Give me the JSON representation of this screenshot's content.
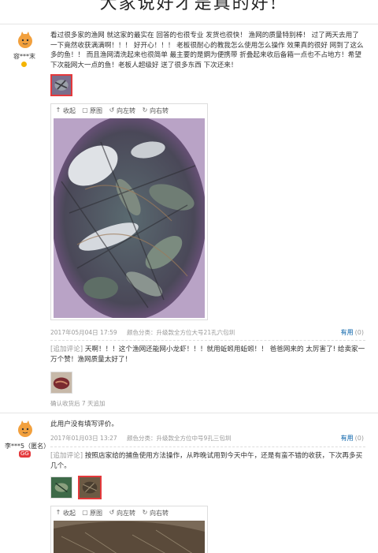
{
  "banner": {
    "text": "大家说好才是真的好!"
  },
  "review1": {
    "user": {
      "name": "容***末",
      "badge": ""
    },
    "content": "看过很多家的渔网 就这家的最实在 回答的也很专业 发货也很快！ 渔网的质量特别棒！ 过了两天去用了一下竟然收获满满啊！！！ 好开心！！！ 老板很耐心的教我怎么使用怎么操作 效果真的很好 网到了这么多的鱼！！ 而且渔网清洗起来也很简单 最主要的是鋼为便携带 折叠起来收后备箱一点也不占地方！希望下次能网大一点的鱼！老板人超级好 送了很多东西 下次还来！",
    "viewer": {
      "tools": [
        {
          "icon": "arrow-up-icon",
          "glyph": "↑",
          "label": "收起"
        },
        {
          "icon": "image-icon",
          "glyph": "▢",
          "label": "原图"
        },
        {
          "icon": "rotate-left-icon",
          "glyph": "↺",
          "label": "向左转"
        },
        {
          "icon": "rotate-right-icon",
          "glyph": "↻",
          "label": "向右转"
        }
      ]
    },
    "date": "2017年05月04日 17:59",
    "spec": "颜色分类：升级款全方位大号21孔六包圳",
    "useful_label": "有用",
    "useful_count": "(0)",
    "followup_tag": "[追加评论]",
    "followup_text": "天啊！！！这个渔网还能网小龙虾！！！就用蚯蚓用蚯蚓！！ 爸爸网来的 太厉害了! 给卖家一万个赞！渔网质量太好了！",
    "receipt": "确认收货后 7 天追加"
  },
  "review2": {
    "user": {
      "name": "李***5（匿名）",
      "badge": "GG"
    },
    "content": "此用户没有填写评价。",
    "date": "2017年01月03日 13:27",
    "spec": "颜色分类：升级款全方位中号9孔三包圳",
    "useful_label": "有用",
    "useful_count": "(0)",
    "followup_tag": "[追加评论]",
    "followup_text": "按照店家给的捕鱼使用方法操作，从昨晚试用到今天中午，还是有蛮不错的收获，下次再多买几个。",
    "viewer": {
      "tools": [
        {
          "icon": "arrow-up-icon",
          "glyph": "↑",
          "label": "收起"
        },
        {
          "icon": "image-icon",
          "glyph": "▢",
          "label": "原图"
        },
        {
          "icon": "rotate-left-icon",
          "glyph": "↺",
          "label": "向左转"
        },
        {
          "icon": "rotate-right-icon",
          "glyph": "↻",
          "label": "向右转"
        }
      ]
    }
  },
  "colors": {
    "accent": "#e4393c",
    "link": "#005ea7",
    "muted": "#999999"
  }
}
